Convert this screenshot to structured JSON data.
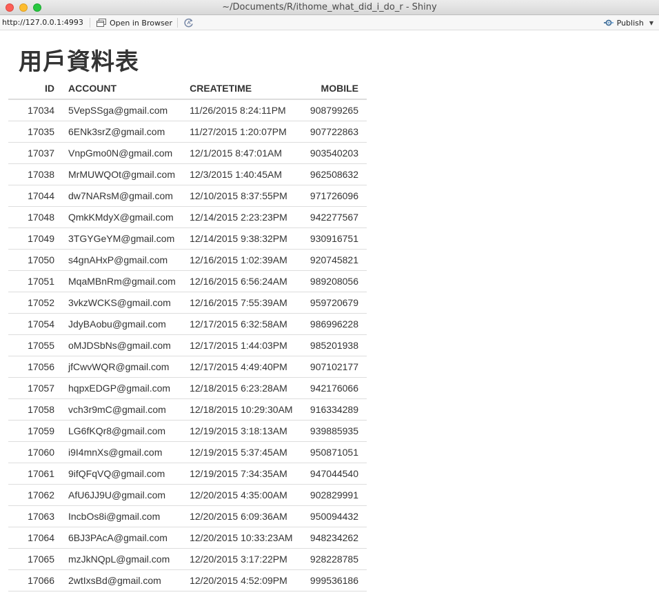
{
  "window": {
    "title": "~/Documents/R/ithome_what_did_i_do_r - Shiny"
  },
  "toolbar": {
    "url": "http://127.0.0.1:4993",
    "open_browser_label": "Open in Browser",
    "publish_label": "Publish"
  },
  "page": {
    "title": "用戶資料表"
  },
  "table": {
    "headers": [
      "ID",
      "ACCOUNT",
      "CREATETIME",
      "MOBILE"
    ],
    "rows": [
      [
        "17034",
        "5VepSSga@gmail.com",
        "11/26/2015 8:24:11PM",
        "908799265"
      ],
      [
        "17035",
        "6ENk3srZ@gmail.com",
        "11/27/2015 1:20:07PM",
        "907722863"
      ],
      [
        "17037",
        "VnpGmo0N@gmail.com",
        "12/1/2015 8:47:01AM",
        "903540203"
      ],
      [
        "17038",
        "MrMUWQOt@gmail.com",
        "12/3/2015 1:40:45AM",
        "962508632"
      ],
      [
        "17044",
        "dw7NARsM@gmail.com",
        "12/10/2015 8:37:55PM",
        "971726096"
      ],
      [
        "17048",
        "QmkKMdyX@gmail.com",
        "12/14/2015 2:23:23PM",
        "942277567"
      ],
      [
        "17049",
        "3TGYGeYM@gmail.com",
        "12/14/2015 9:38:32PM",
        "930916751"
      ],
      [
        "17050",
        "s4gnAHxP@gmail.com",
        "12/16/2015 1:02:39AM",
        "920745821"
      ],
      [
        "17051",
        "MqaMBnRm@gmail.com",
        "12/16/2015 6:56:24AM",
        "989208056"
      ],
      [
        "17052",
        "3vkzWCKS@gmail.com",
        "12/16/2015 7:55:39AM",
        "959720679"
      ],
      [
        "17054",
        "JdyBAobu@gmail.com",
        "12/17/2015 6:32:58AM",
        "986996228"
      ],
      [
        "17055",
        "oMJDSbNs@gmail.com",
        "12/17/2015 1:44:03PM",
        "985201938"
      ],
      [
        "17056",
        "jfCwvWQR@gmail.com",
        "12/17/2015 4:49:40PM",
        "907102177"
      ],
      [
        "17057",
        "hqpxEDGP@gmail.com",
        "12/18/2015 6:23:28AM",
        "942176066"
      ],
      [
        "17058",
        "vch3r9mC@gmail.com",
        "12/18/2015 10:29:30AM",
        "916334289"
      ],
      [
        "17059",
        "LG6fKQr8@gmail.com",
        "12/19/2015 3:18:13AM",
        "939885935"
      ],
      [
        "17060",
        "i9I4mnXs@gmail.com",
        "12/19/2015 5:37:45AM",
        "950871051"
      ],
      [
        "17061",
        "9ifQFqVQ@gmail.com",
        "12/19/2015 7:34:35AM",
        "947044540"
      ],
      [
        "17062",
        "AfU6JJ9U@gmail.com",
        "12/20/2015 4:35:00AM",
        "902829991"
      ],
      [
        "17063",
        "IncbOs8i@gmail.com",
        "12/20/2015 6:09:36AM",
        "950094432"
      ],
      [
        "17064",
        "6BJ3PAcA@gmail.com",
        "12/20/2015 10:33:23AM",
        "948234262"
      ],
      [
        "17065",
        "mzJkNQpL@gmail.com",
        "12/20/2015 3:17:22PM",
        "928228785"
      ],
      [
        "17066",
        "2wtIxsBd@gmail.com",
        "12/20/2015 4:52:09PM",
        "999536186"
      ]
    ]
  },
  "icons": {
    "open_browser": "browser-window-icon",
    "refresh": "refresh-icon",
    "publish": "publish-icon"
  }
}
